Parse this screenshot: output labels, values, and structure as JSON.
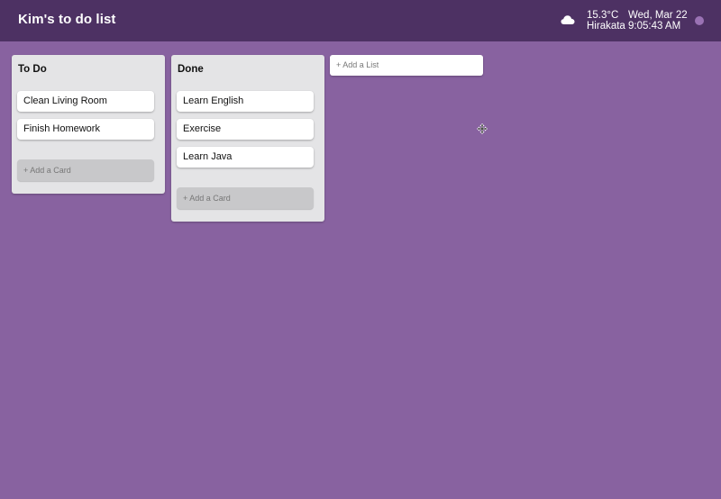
{
  "header": {
    "title": "Kim's to do list",
    "weather_icon": "cloud-icon",
    "temperature": "15.3°C",
    "location": "Hirakata",
    "date": "Wed, Mar 22",
    "time": "9:05:43 AM"
  },
  "lists": [
    {
      "title": "To Do",
      "cards": [
        "Clean Living Room",
        "Finish Homework"
      ],
      "add_card_label": "+ Add a Card"
    },
    {
      "title": "Done",
      "cards": [
        "Learn English",
        "Exercise",
        "Learn Java"
      ],
      "add_card_label": "+ Add a Card"
    }
  ],
  "add_list_label": "+ Add a List",
  "cursor_icon": "move-cursor-icon",
  "colors": {
    "background": "#8862a0",
    "header": "#4d3163",
    "list": "#e4e4e6",
    "card": "#ffffff",
    "add_card": "#c8c8ca",
    "status_dot": "#9a72b4"
  }
}
